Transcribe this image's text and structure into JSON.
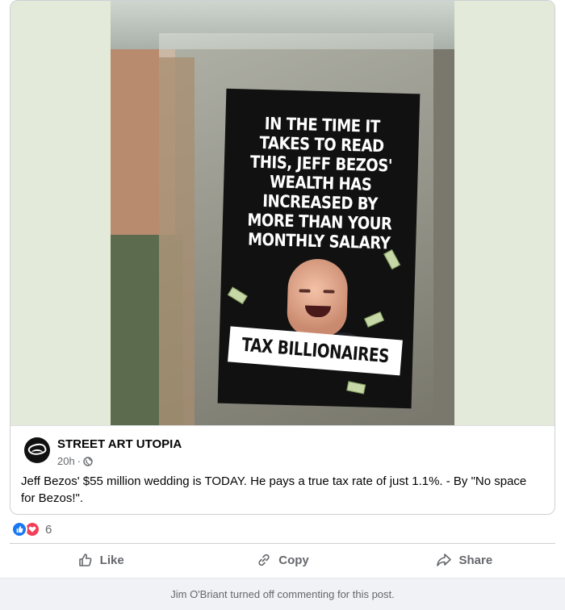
{
  "photo": {
    "poster_headline": "IN THE TIME IT TAKES TO READ THIS, JEFF BEZOS' WEALTH HAS INCREASED BY MORE THAN YOUR MONTHLY SALARY",
    "poster_banner": "TAX BILLIONAIRES"
  },
  "post": {
    "page_name": "STREET ART UTOPIA",
    "time": "20h",
    "separator": "·",
    "privacy_icon": "globe-icon",
    "text": "Jeff Bezos' $55 million wedding is TODAY. He pays a true tax rate of just 1.1%. - By \"No space for Bezos!\"."
  },
  "reactions": {
    "types": [
      "like-icon",
      "love-icon"
    ],
    "count": "6"
  },
  "actions": {
    "like_label": "Like",
    "copy_label": "Copy",
    "share_label": "Share"
  },
  "comments_notice": "Jim O'Briant turned off commenting for this post.",
  "colors": {
    "like_blue": "#1877f2",
    "love_red": "#f33e58",
    "secondary_text": "#65676b",
    "photo_backdrop": "#e3ead9"
  }
}
